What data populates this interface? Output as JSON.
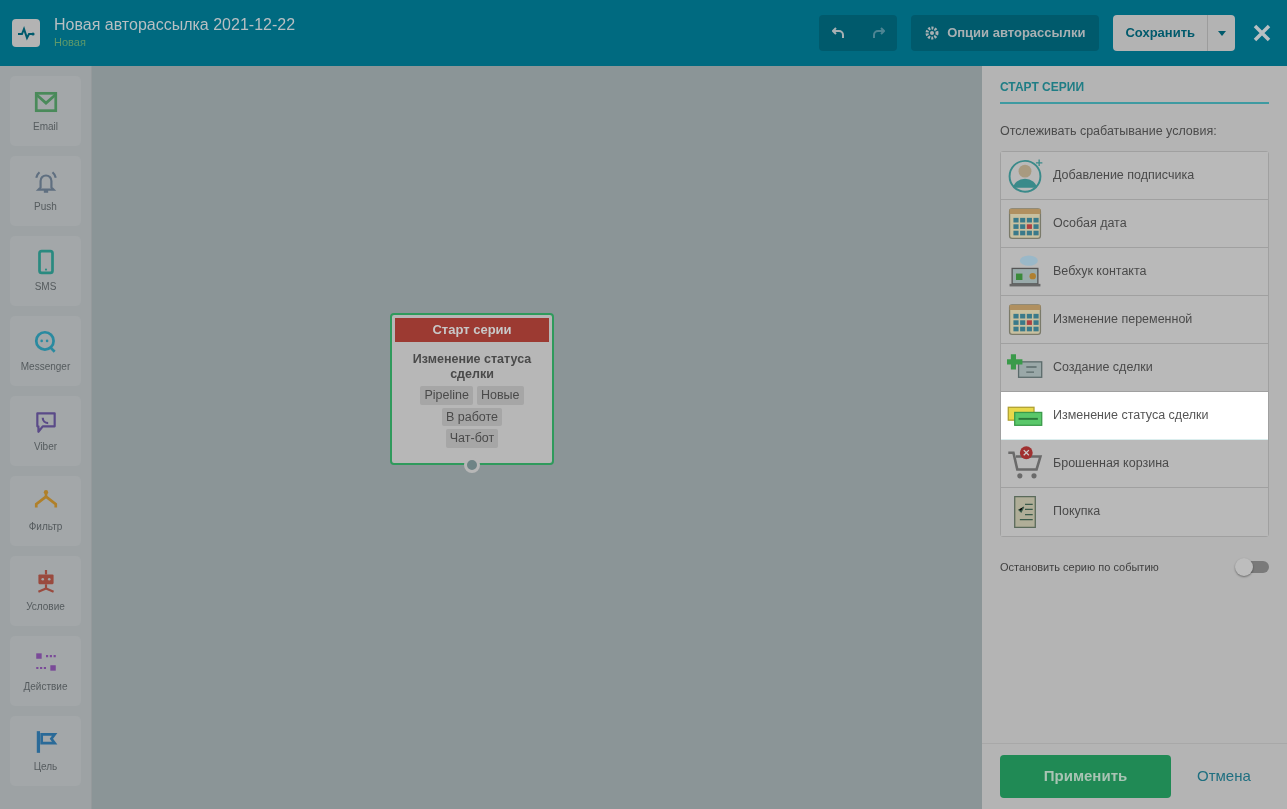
{
  "header": {
    "title": "Новая авторассылка 2021-12-22",
    "status": "Новая",
    "undo": {
      "disabled": false
    },
    "redo": {
      "disabled": true
    },
    "options_button": "Опции авторассылки",
    "save_button": "Сохранить"
  },
  "tools": [
    {
      "label": "Email"
    },
    {
      "label": "Push"
    },
    {
      "label": "SMS"
    },
    {
      "label": "Messenger"
    },
    {
      "label": "Viber"
    },
    {
      "label": "Фильтр"
    },
    {
      "label": "Условие"
    },
    {
      "label": "Действие"
    },
    {
      "label": "Цель"
    }
  ],
  "node": {
    "header": "Старт серии",
    "title": "Изменение статуса сделки",
    "tags": [
      "Pipeline",
      "Новые",
      "В работе",
      "Чат-бот"
    ]
  },
  "panel": {
    "heading": "СТАРТ СЕРИИ",
    "prompt": "Отслеживать срабатывание условия:",
    "triggers": [
      {
        "label": "Добавление подписчика",
        "highlighted": false
      },
      {
        "label": "Особая дата",
        "highlighted": false
      },
      {
        "label": "Вебхук контакта",
        "highlighted": false
      },
      {
        "label": "Изменение переменной",
        "highlighted": false
      },
      {
        "label": "Создание сделки",
        "highlighted": false
      },
      {
        "label": "Изменение статуса сделки",
        "highlighted": true
      },
      {
        "label": "Брошенная корзина",
        "highlighted": false
      },
      {
        "label": "Покупка",
        "highlighted": false
      }
    ],
    "stop_toggle": {
      "label": "Остановить серию по событию",
      "on": false
    },
    "apply_button": "Применить",
    "cancel_link": "Отмена"
  }
}
